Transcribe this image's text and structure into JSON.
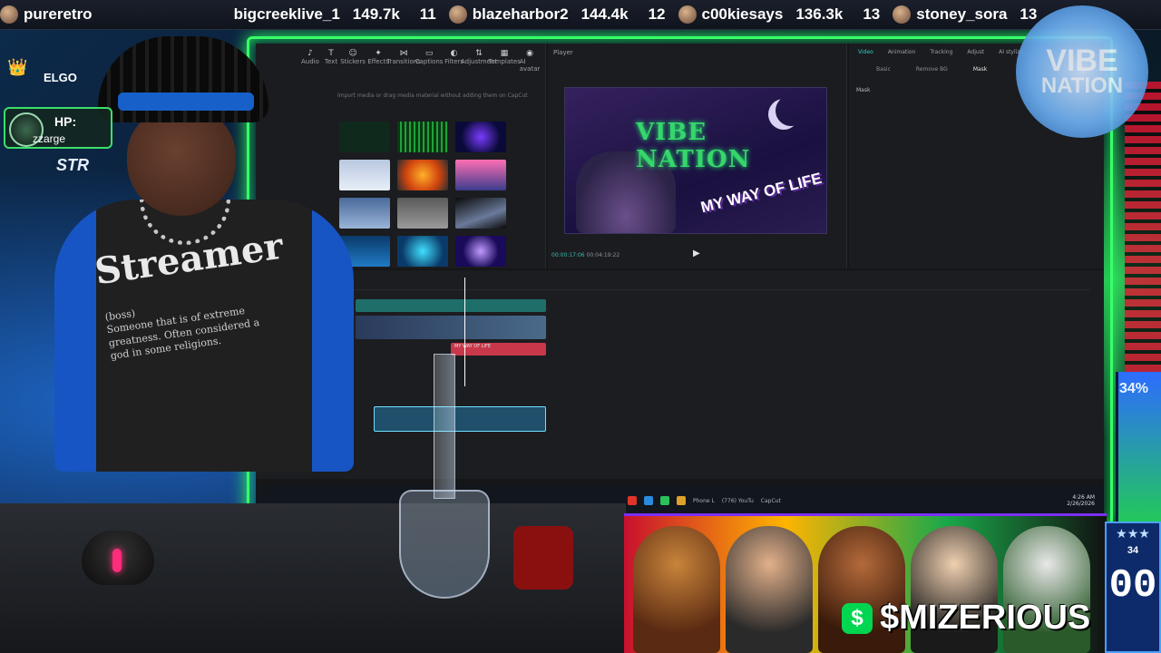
{
  "ticker": [
    {
      "rank": "",
      "name": "pureretro",
      "score": ""
    },
    {
      "rank": "",
      "name": "bigcreeklive_1",
      "score": "149.7k"
    },
    {
      "rank": "11",
      "name": "blazeharbor2",
      "score": "144.4k"
    },
    {
      "rank": "12",
      "name": "c00kiesays",
      "score": "136.3k"
    },
    {
      "rank": "13",
      "name": "stoney_sora",
      "score": "13"
    }
  ],
  "vibe_logo": {
    "line1": "VIBE",
    "line2": "NATION"
  },
  "chat": {
    "crown": "👑",
    "name": "ELGO",
    "hp_label": "HP:",
    "hp_user": "zzarge",
    "badge": "STR"
  },
  "editor": {
    "toolbar": [
      "Audio",
      "Text",
      "Stickers",
      "Effects",
      "Transitions",
      "Captions",
      "Filters",
      "Adjustment",
      "Templates",
      "AI avatar"
    ],
    "import_hint": "Import media or drag media material without adding them on CapCut",
    "player_label": "Player",
    "preview_title": "VIBE NATION",
    "preview_subtitle": "MY WAY OF LIFE",
    "time_current": "00:00:17:06",
    "time_total": "00:04:19:22",
    "props_tabs": [
      "Video",
      "Animation",
      "Tracking",
      "Adjust",
      "AI stylize"
    ],
    "props_subtabs": [
      "Basic",
      "Remove BG",
      "Mask"
    ],
    "mask_label": "Mask",
    "track_label": "MY WAY OF LIFE",
    "clock_time": "4:26 AM",
    "clock_date": "2/26/2026",
    "taskbar_phone": "Phone L",
    "taskbar_youtube": "(776) YouTu",
    "taskbar_capcut": "CapCut"
  },
  "shirt": {
    "word": "Streamer",
    "pos": "(boss)",
    "definition": "Someone that is of extreme greatness. Often considered a god in some religions."
  },
  "cashtag": {
    "icon": "$",
    "text": "$MIZERIOUS"
  },
  "goal": {
    "percent": "34%",
    "level": 0.34
  },
  "counter": {
    "stars": "★★★",
    "small": "34",
    "big": "00"
  },
  "colors": {
    "neon_green": "#39ff6a",
    "accent_teal": "#2bd0c2",
    "cash_green": "#00d64f"
  }
}
